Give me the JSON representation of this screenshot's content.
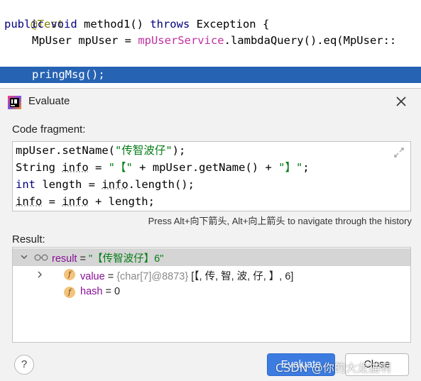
{
  "editor": {
    "lines": [
      {
        "parts": [
          "@Test"
        ]
      },
      {
        "parts": [
          "public void ",
          "method1",
          "() ",
          "throws ",
          "Exception {"
        ]
      },
      {
        "parts": [
          "MpUser mpUser = ",
          "mpUserService",
          ".lambdaQuery().eq(MpUser::"
        ]
      },
      {
        "parts": [
          "pringMsg();"
        ]
      }
    ]
  },
  "dialog": {
    "title": "Evaluate",
    "code_label": "Code fragment:",
    "code_lines": [
      [
        "mpUser.setName(",
        "\"传智波仔\"",
        ");"
      ],
      [
        "String ",
        "info",
        " = ",
        "\"【\"",
        " + mpUser.getName() + ",
        "\"】\"",
        ";"
      ],
      [
        "int",
        " length = ",
        "info",
        ".length();"
      ],
      [
        "info",
        " = ",
        "info",
        " + length;"
      ]
    ],
    "hint": "Press Alt+向下箭头, Alt+向上箭头 to navigate through the history",
    "result_label": "Result:",
    "result": {
      "name": "result",
      "eq": " = ",
      "value": "\"【传智波仔】6\""
    },
    "value_field": {
      "name": "value",
      "eq": " = ",
      "ref": "{char[7]@8873}",
      "content": " [【, 传, 智, 波, 仔, 】, 6]"
    },
    "hash_field": {
      "name": "hash",
      "eq": " = ",
      "value": "0"
    },
    "help_label": "?",
    "evaluate_label": "Evaluate",
    "close_label": "Close"
  },
  "watermark": "CSDN @你的大龙猫啊",
  "colors": {
    "accent": "#3c7ce0",
    "selection": "#2663b3",
    "string": "#067d17",
    "keyword": "#000080",
    "annotation": "#808000",
    "field": "#871094"
  },
  "icons": [
    "intellij-app-icon",
    "close-icon",
    "expand-icon",
    "chevron-down-icon",
    "chevron-right-icon",
    "glasses-icon",
    "field-icon",
    "help-icon"
  ]
}
